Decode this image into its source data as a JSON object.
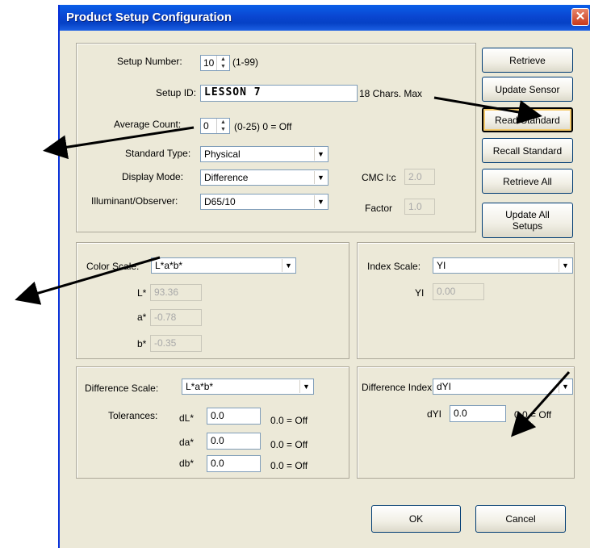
{
  "window": {
    "title": "Product Setup Configuration",
    "close_glyph": "✕"
  },
  "setup": {
    "setup_number_label": "Setup Number:",
    "setup_number_value": "10",
    "setup_number_range": "(1-99)",
    "setup_id_label": "Setup ID:",
    "setup_id_value": "LESSON 7",
    "setup_id_hint": "18 Chars. Max",
    "average_count_label": "Average Count:",
    "average_count_value": "0",
    "average_count_hint": "(0-25) 0 = Off",
    "standard_type_label": "Standard Type:",
    "standard_type_value": "Physical",
    "display_mode_label": "Display Mode:",
    "display_mode_value": "Difference",
    "illuminant_label": "Illuminant/Observer:",
    "illuminant_value": "D65/10",
    "cmc_label": "CMC l:c",
    "cmc_value": "2.0",
    "factor_label": "Factor",
    "factor_value": "1.0"
  },
  "buttons": {
    "retrieve": "Retrieve",
    "update_sensor": "Update Sensor",
    "read_standard": "Read Standard",
    "recall_standard": "Recall Standard",
    "retrieve_all": "Retrieve All",
    "update_all_line1": "Update All",
    "update_all_line2": "Setups",
    "ok": "OK",
    "cancel": "Cancel"
  },
  "color_scale": {
    "label": "Color Scale:",
    "value": "L*a*b*",
    "fields": [
      {
        "label": "L*",
        "value": "93.36"
      },
      {
        "label": "a*",
        "value": "-0.78"
      },
      {
        "label": "b*",
        "value": "-0.35"
      }
    ]
  },
  "index_scale": {
    "label": "Index Scale:",
    "value": "YI",
    "field_label": "YI",
    "field_value": "0.00"
  },
  "difference_scale": {
    "label": "Difference Scale:",
    "value": "L*a*b*",
    "tolerances_label": "Tolerances:",
    "rows": [
      {
        "label": "dL*",
        "value": "0.0",
        "hint": "0.0 = Off"
      },
      {
        "label": "da*",
        "value": "0.0",
        "hint": "0.0 = Off"
      },
      {
        "label": "db*",
        "value": "0.0",
        "hint": "0.0 = Off"
      }
    ]
  },
  "difference_index": {
    "label": "Difference Index:",
    "value": "dYI",
    "field_label": "dYI",
    "field_value": "0.0",
    "hint": "0.0 = Off"
  },
  "icons": {
    "dropdown": "▼",
    "spin_up": "▲",
    "spin_down": "▼"
  },
  "colors": {
    "title_bar": "#0a46d1",
    "dialog_bg": "#ece9d8",
    "close_button": "#c8391b"
  }
}
